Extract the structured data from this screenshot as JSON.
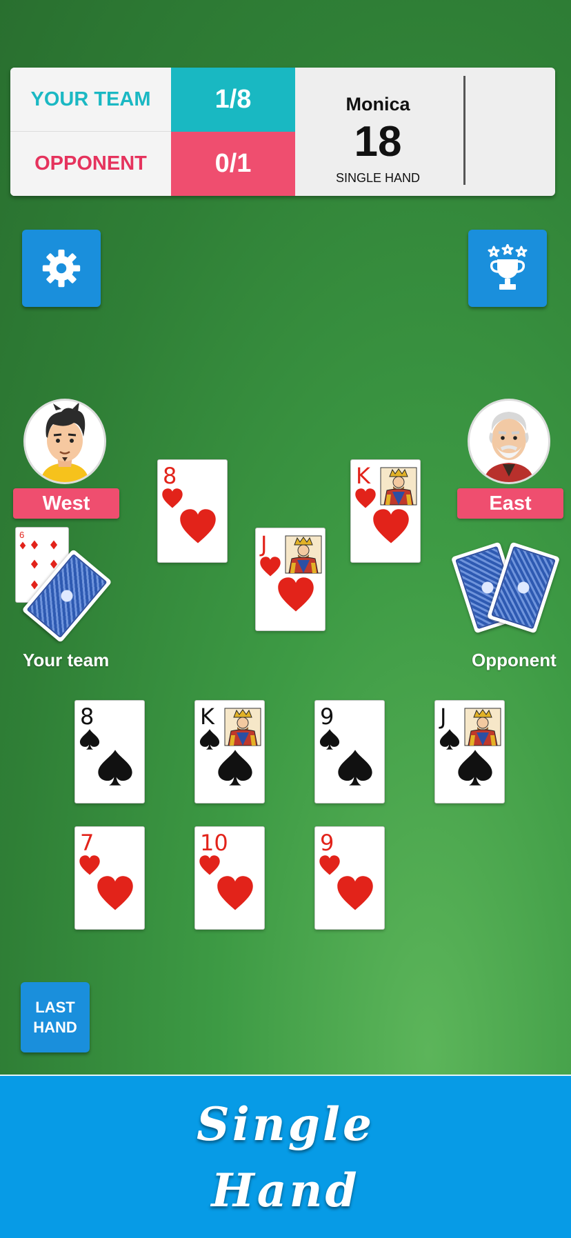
{
  "scoreboard": {
    "your_team_label": "YOUR TEAM",
    "your_team_score": "1/8",
    "opponent_label": "OPPONENT",
    "opponent_score": "0/1",
    "player_name": "Monica",
    "points": "18",
    "mode": "SINGLE HAND"
  },
  "buttons": {
    "settings_icon": "gear-icon",
    "trophy_icon": "trophy-stars-icon",
    "last_hand_line1": "LAST",
    "last_hand_line2": "HAND"
  },
  "players": {
    "west": {
      "name": "West",
      "avatar": "young-man-avatar"
    },
    "east": {
      "name": "East",
      "avatar": "old-man-avatar"
    }
  },
  "piles": {
    "your_team_label": "Your team",
    "your_team_top_card": "6",
    "opponent_label": "Opponent"
  },
  "trick": [
    {
      "rank": "8",
      "suit": "hearts"
    },
    {
      "rank": "J",
      "suit": "hearts"
    },
    {
      "rank": "K",
      "suit": "hearts"
    }
  ],
  "hand": {
    "row1": [
      {
        "rank": "8",
        "suit": "spades"
      },
      {
        "rank": "K",
        "suit": "spades"
      },
      {
        "rank": "9",
        "suit": "spades"
      },
      {
        "rank": "J",
        "suit": "spades"
      }
    ],
    "row2": [
      {
        "rank": "7",
        "suit": "hearts"
      },
      {
        "rank": "10",
        "suit": "hearts"
      },
      {
        "rank": "9",
        "suit": "hearts"
      }
    ]
  },
  "banner": {
    "line1": "Single",
    "line2": "Hand"
  },
  "colors": {
    "felt": "#3d9a44",
    "team_teal": "#19b8c2",
    "opponent_pink": "#ef4e6f",
    "button_blue": "#1a8fdc",
    "banner_blue": "#079be6"
  }
}
